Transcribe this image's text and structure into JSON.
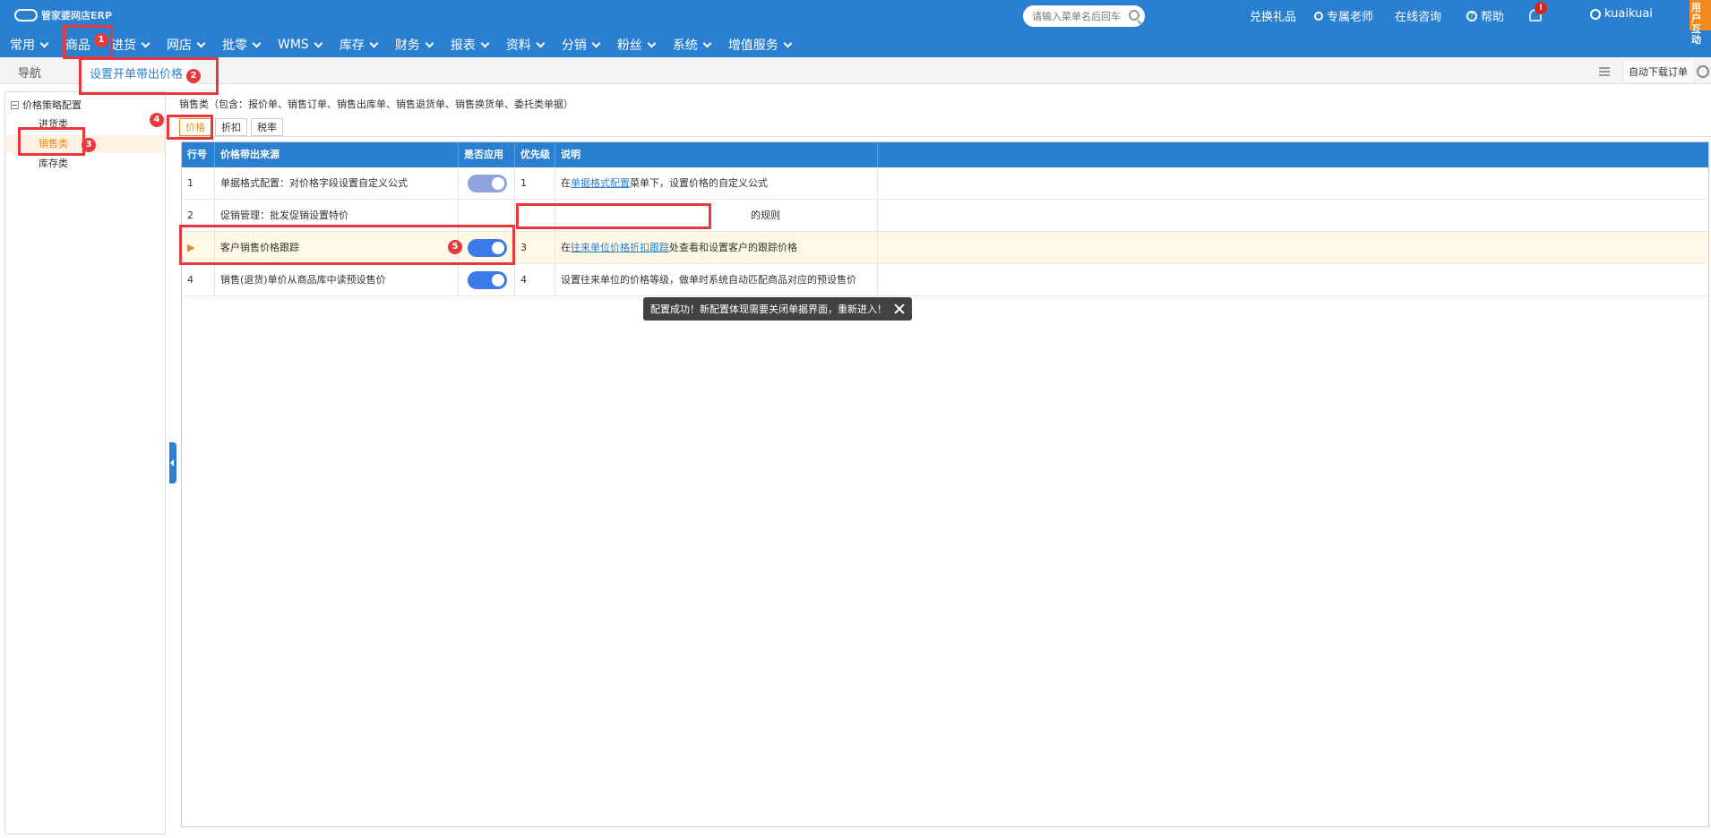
{
  "app": {
    "logo": "管家婆网店ERP",
    "search_placeholder": "请输入菜单名后回车",
    "links": [
      "兑换礼品",
      "专属老师",
      "在线咨询",
      "帮助"
    ],
    "notification_badge": "!",
    "username": "kuaikuai",
    "corner_badge": "用户互动"
  },
  "menu": [
    "常用",
    "商品",
    "进货",
    "网店",
    "批零",
    "WMS",
    "库存",
    "财务",
    "报表",
    "资料",
    "分销",
    "粉丝",
    "系统",
    "增值服务"
  ],
  "tabs": {
    "nav": "导航",
    "active": "设置开单带出价格",
    "tool_button": "自动下载订单"
  },
  "tree": {
    "root": "价格策略配置",
    "items": [
      "进货类",
      "销售类",
      "库存类"
    ]
  },
  "content": {
    "description": "销售类（包含：报价单、销售订单、销售出库单、销售退货单、销售换货单、委托类单据）",
    "subtabs": [
      "价格",
      "折扣",
      "税率"
    ],
    "columns": [
      "行号",
      "价格带出来源",
      "是否应用",
      "优先级",
      "说明"
    ],
    "rows": [
      {
        "no": "1",
        "source": "单据格式配置：对价格字段设置自定义公式",
        "priority": "1",
        "desc_pre": "在",
        "desc_link": "单据格式配置",
        "desc_post": "菜单下，设置价格的自定义公式"
      },
      {
        "no": "2",
        "source": "促销管理：批发促销设置特价",
        "priority": "",
        "desc_pre": "",
        "desc_link": "",
        "desc_post": "的规则"
      },
      {
        "no": "▶",
        "source": "客户销售价格跟踪",
        "priority": "3",
        "desc_pre": "在",
        "desc_link": "往来单位价格折扣跟踪",
        "desc_post": "处查看和设置客户的跟踪价格"
      },
      {
        "no": "4",
        "source": "销售(退货)单价从商品库中读预设售价",
        "priority": "4",
        "desc_pre": "",
        "desc_link": "",
        "desc_post": "设置往来单位的价格等级，做单时系统自动匹配商品对应的预设售价"
      }
    ],
    "toast": "配置成功！新配置体现需要关闭单据界面，重新进入！"
  },
  "annotations": [
    "1",
    "2",
    "3",
    "4",
    "5"
  ]
}
